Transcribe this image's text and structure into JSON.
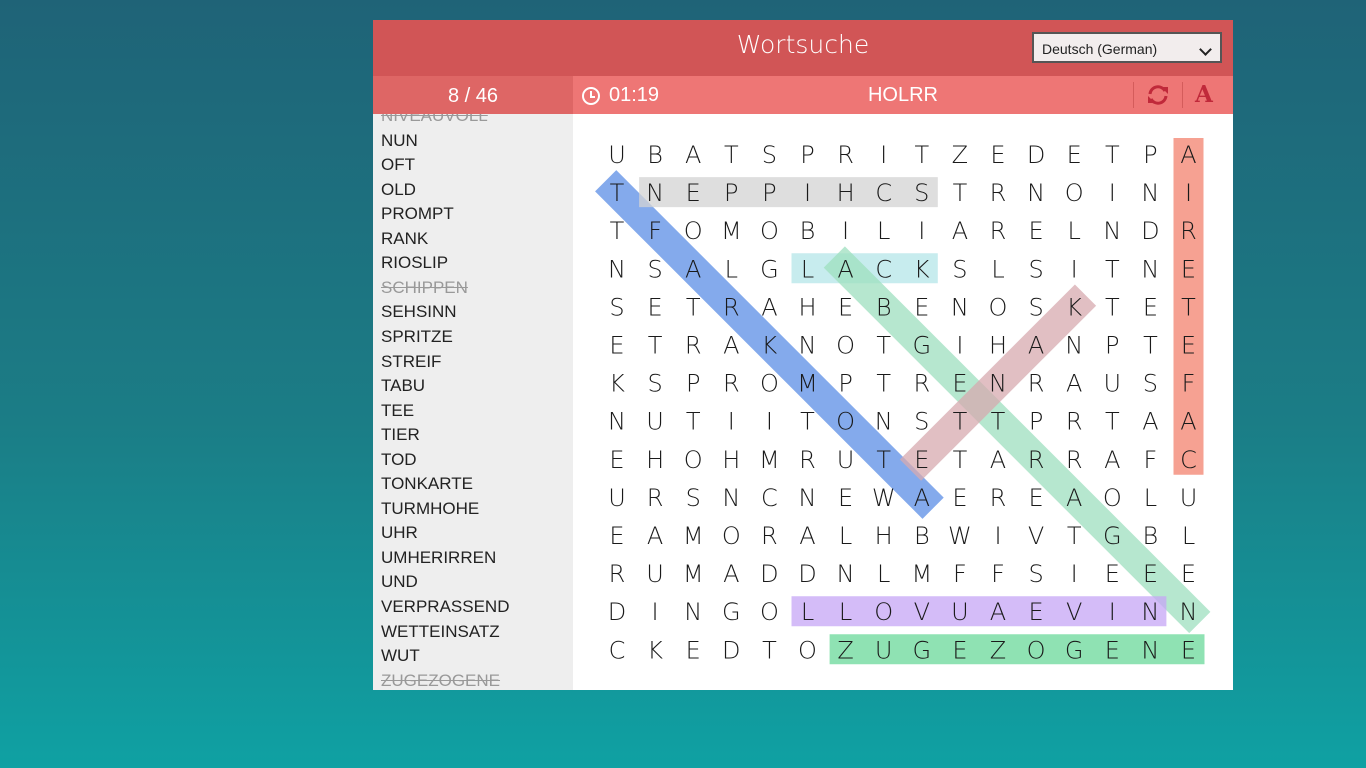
{
  "header": {
    "title": "Wortsuche",
    "language": "Deutsch (German)"
  },
  "status": {
    "progress": "8 / 46",
    "timer": "01:19",
    "current_selection": "HOLRR"
  },
  "icons": {
    "timer": "clock-icon",
    "new_game": "refresh-icon",
    "font": "font-icon"
  },
  "words": [
    {
      "text": "NIVEAUVOLL",
      "found": true
    },
    {
      "text": "NUN",
      "found": false
    },
    {
      "text": "OFT",
      "found": false
    },
    {
      "text": "OLD",
      "found": false
    },
    {
      "text": "PROMPT",
      "found": false
    },
    {
      "text": "RANK",
      "found": false
    },
    {
      "text": "RIOSLIP",
      "found": false
    },
    {
      "text": "SCHIPPEN",
      "found": true
    },
    {
      "text": "SEHSINN",
      "found": false
    },
    {
      "text": "SPRITZE",
      "found": false
    },
    {
      "text": "STREIF",
      "found": false
    },
    {
      "text": "TABU",
      "found": false
    },
    {
      "text": "TEE",
      "found": false
    },
    {
      "text": "TIER",
      "found": false
    },
    {
      "text": "TOD",
      "found": false
    },
    {
      "text": "TONKARTE",
      "found": false
    },
    {
      "text": "TURMHOHE",
      "found": false
    },
    {
      "text": "UHR",
      "found": false
    },
    {
      "text": "UMHERIRREN",
      "found": false
    },
    {
      "text": "UND",
      "found": false
    },
    {
      "text": "VERPRASSEND",
      "found": false
    },
    {
      "text": "WETTEINSATZ",
      "found": false
    },
    {
      "text": "WUT",
      "found": false
    },
    {
      "text": "ZUGEZOGENE",
      "found": true
    }
  ],
  "grid": [
    "UBATSPRITZEDETPA",
    "TNEPPIHCSTRNOINI",
    "TFOMOBILIARELNDR",
    "NSALGLACKSLSITNE",
    "SETRAHEBENOSKTET",
    "ETRAKNOTGIHANPTE",
    "KSPROMPTRENRAUSF",
    "NUTIITONSTTPRTAA",
    "EHOHMRUTETARRAFC",
    "URSNCNEWAEREAOLU",
    "EAMORALHBWIVTGBL",
    "RUMADDNLMFFSIEEE",
    "DINGOLLOVUAEVINN",
    "CKEDTOZUGEZOGENE"
  ],
  "highlights": [
    {
      "from": [
        1,
        0
      ],
      "to": [
        9,
        8
      ],
      "color": "#5b8ee6"
    },
    {
      "from": [
        1,
        1
      ],
      "to": [
        1,
        8
      ],
      "color": "#d4d4d4"
    },
    {
      "from": [
        0,
        15
      ],
      "to": [
        8,
        15
      ],
      "color": "#f4826e"
    },
    {
      "from": [
        3,
        5
      ],
      "to": [
        3,
        8
      ],
      "color": "#b5e6e9"
    },
    {
      "from": [
        3,
        6
      ],
      "to": [
        12,
        15
      ],
      "color": "#9ee0bf"
    },
    {
      "from": [
        4,
        12
      ],
      "to": [
        8,
        8
      ],
      "color": "#d7aab0"
    },
    {
      "from": [
        12,
        5
      ],
      "to": [
        12,
        14
      ],
      "color": "#c6a6f6"
    },
    {
      "from": [
        13,
        6
      ],
      "to": [
        13,
        15
      ],
      "color": "#6ad99a"
    }
  ],
  "colors": {
    "titlebar": "#d15556",
    "counterbar": "#de6665",
    "infobar": "#ee7675",
    "font_icon": "#c0293a"
  }
}
